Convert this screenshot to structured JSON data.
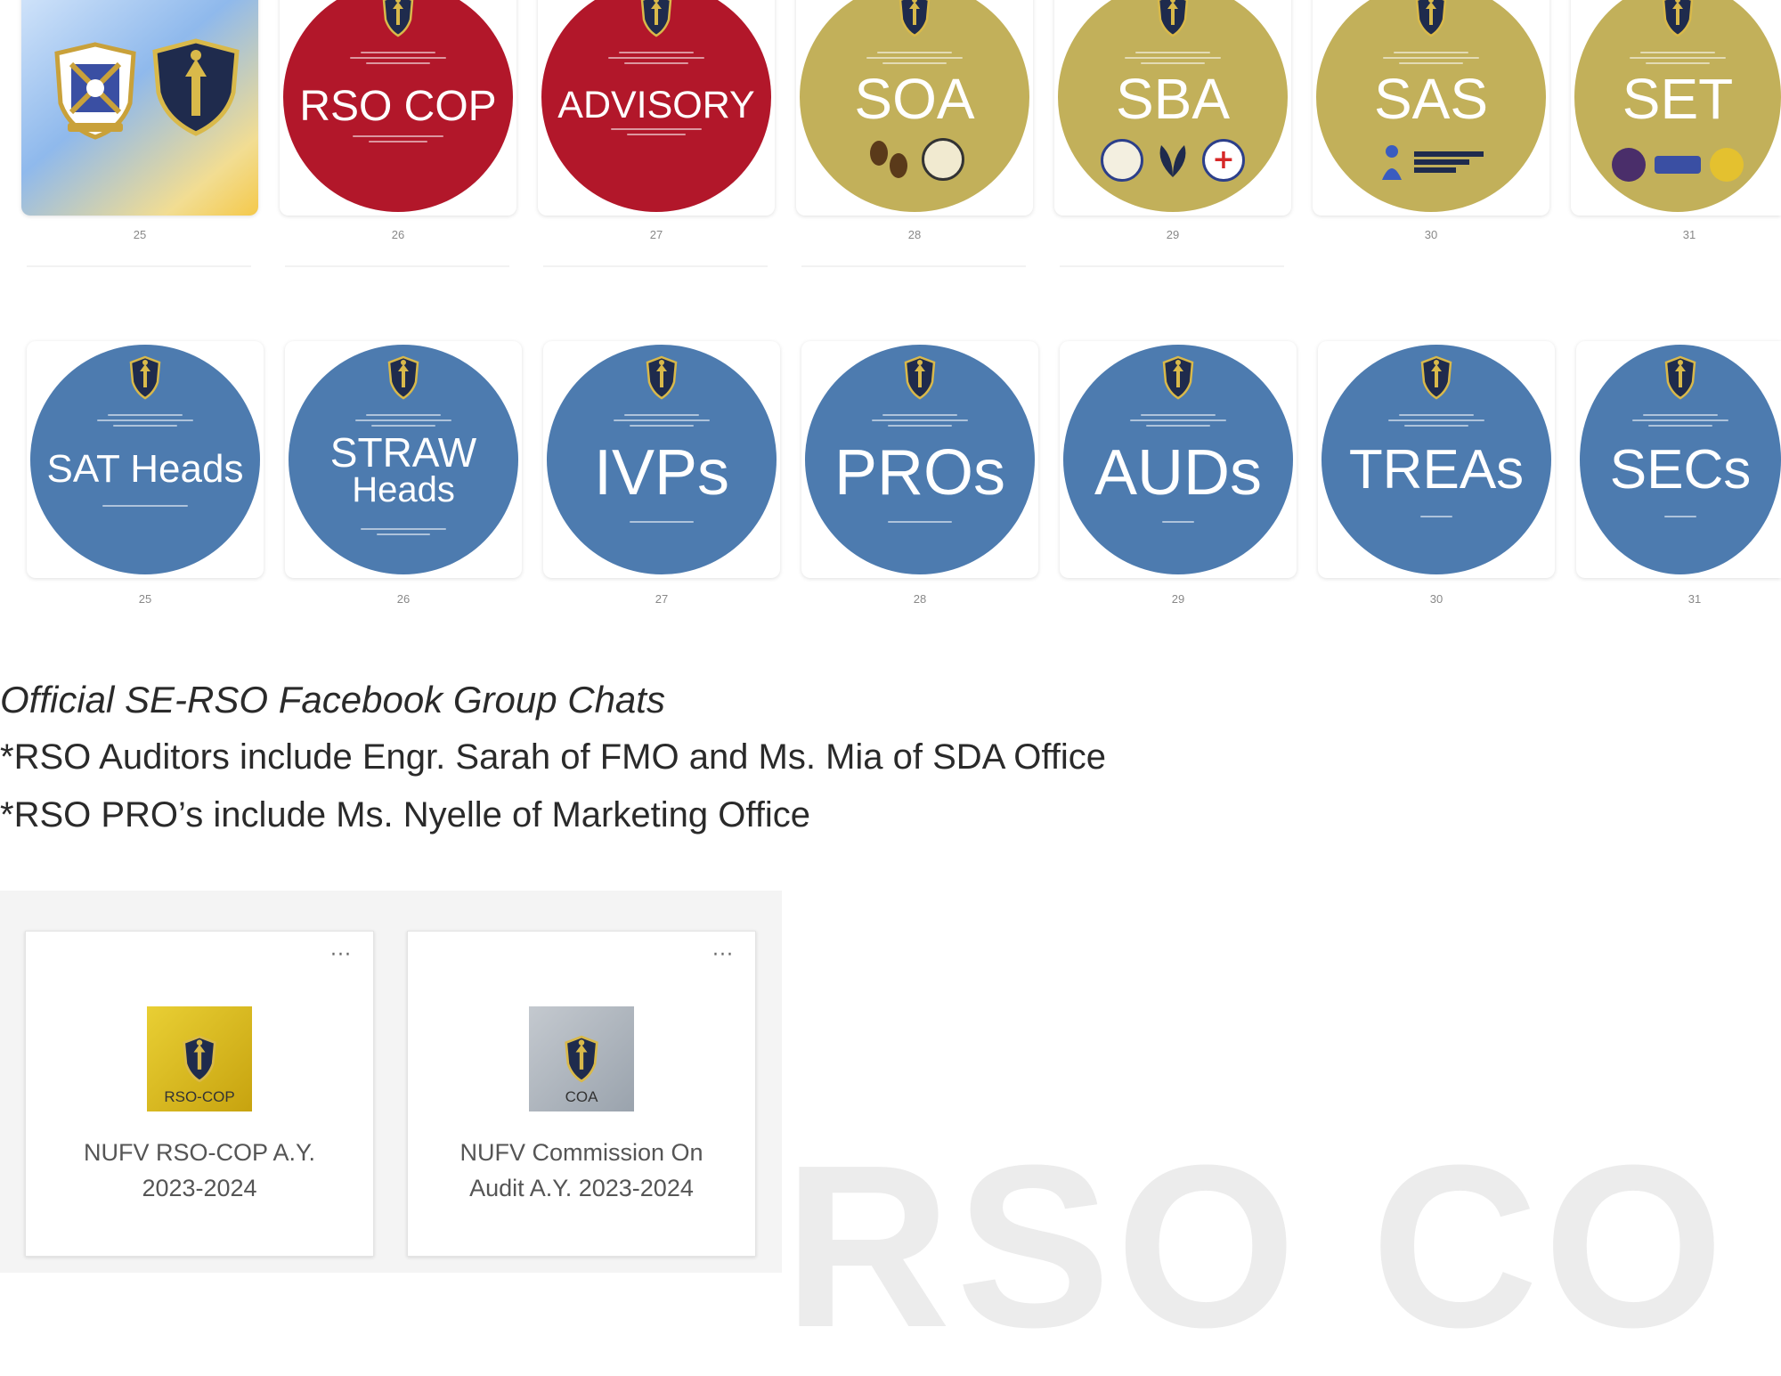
{
  "slides_row_1": [
    {
      "page": "25",
      "type": "logo",
      "name": "nu-fairview-logos"
    },
    {
      "page": "26",
      "type": "circle",
      "color": "#b2172a",
      "title": "RSO COP"
    },
    {
      "page": "27",
      "type": "circle",
      "color": "#b2172a",
      "title": "ADVISORY"
    },
    {
      "page": "28",
      "type": "circle",
      "color": "#c2b05a",
      "title": "SOA"
    },
    {
      "page": "29",
      "type": "circle",
      "color": "#c2b05a",
      "title": "SBA"
    },
    {
      "page": "30",
      "type": "circle",
      "color": "#c2b05a",
      "title": "SAS"
    },
    {
      "page": "31",
      "type": "circle",
      "color": "#c2b05a",
      "title": "SET"
    }
  ],
  "slides_row_2": [
    {
      "page": "25",
      "color": "#4d7baf",
      "title": "SAT Heads"
    },
    {
      "page": "26",
      "color": "#4d7baf",
      "title_line1": "STRAW",
      "title_line2": "Heads"
    },
    {
      "page": "27",
      "color": "#4d7baf",
      "title": "IVPs"
    },
    {
      "page": "28",
      "color": "#4d7baf",
      "title": "PROs"
    },
    {
      "page": "29",
      "color": "#4d7baf",
      "title": "AUDs"
    },
    {
      "page": "30",
      "color": "#4d7baf",
      "title": "TREAs"
    },
    {
      "page": "31",
      "color": "#4d7baf",
      "title": "SECs"
    }
  ],
  "captions": {
    "heading": "Official SE-RSO Facebook Group Chats",
    "note1": "*RSO Auditors include Engr. Sarah of FMO and Ms. Mia of SDA Office",
    "note2": "*RSO PRO’s include Ms. Nyelle of Marketing Office"
  },
  "group_chats": [
    {
      "thumb_label": "RSO-COP",
      "title_line1": "NUFV RSO-COP A.Y.",
      "title_line2": "2023-2024",
      "menu": "···"
    },
    {
      "thumb_label": "COA",
      "title_line1": "NUFV Commission On",
      "title_line2": "Audit A.Y. 2023-2024",
      "menu": "···"
    }
  ],
  "watermark": "RSO CO"
}
